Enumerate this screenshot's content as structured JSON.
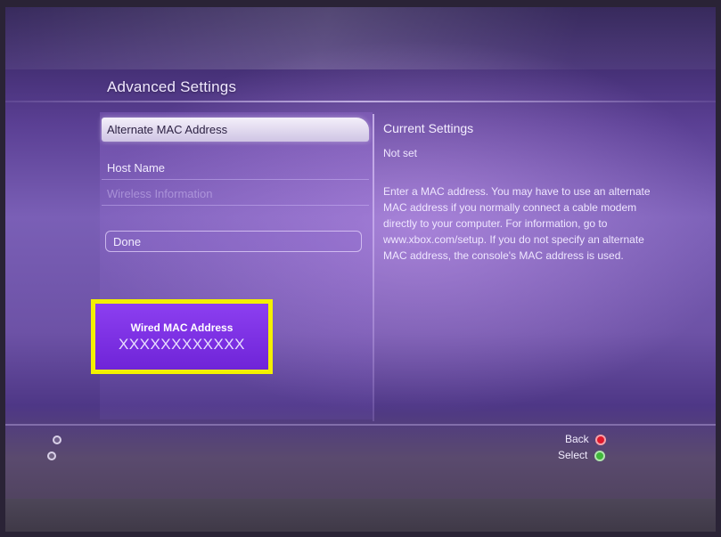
{
  "screen": {
    "title": "Advanced Settings"
  },
  "menu": {
    "items": [
      {
        "label": "Alternate MAC Address",
        "state": "selected"
      },
      {
        "label": "Host Name",
        "state": "normal"
      },
      {
        "label": "Wireless Information",
        "state": "disabled"
      }
    ],
    "done_label": "Done"
  },
  "highlight": {
    "label": "Wired MAC Address",
    "value": "XXXXXXXXXXXX",
    "border_color": "#f3f000",
    "fill_color": "#7b2fe6"
  },
  "current_settings": {
    "title": "Current Settings",
    "value": "Not set",
    "description": "Enter a MAC address. You may have to use an alternate MAC address if you normally connect a cable modem directly to your computer. For information, go to www.xbox.com/setup. If you do not specify an alternate MAC address, the console's MAC address is used."
  },
  "footer": {
    "back_label": "Back",
    "select_label": "Select",
    "back_button_color": "#e0182c",
    "select_button_color": "#3fb83a",
    "left_icons": [
      "controller-port-icon",
      "controller-port-icon"
    ]
  }
}
